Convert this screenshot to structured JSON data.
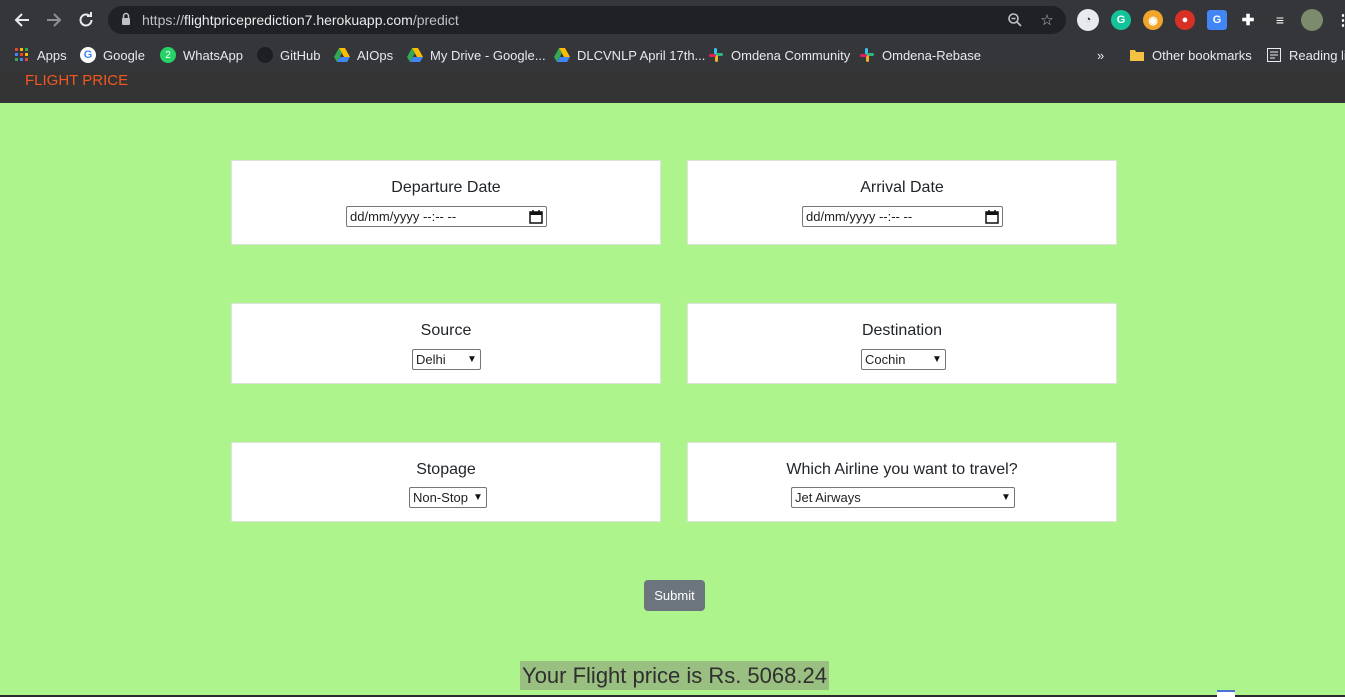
{
  "browser": {
    "url_scheme": "https://",
    "url_host": "flightpriceprediction7.herokuapp.com",
    "url_path": "/predict",
    "bookmarks": [
      {
        "label": "Apps",
        "icon": "apps-grid-icon"
      },
      {
        "label": "Google",
        "icon": "google-icon"
      },
      {
        "label": "WhatsApp",
        "icon": "whatsapp-icon"
      },
      {
        "label": "GitHub",
        "icon": "github-icon"
      },
      {
        "label": "AIOps",
        "icon": "google-drive-icon"
      },
      {
        "label": "My Drive - Google...",
        "icon": "google-drive-icon"
      },
      {
        "label": "DLCVNLP April 17th...",
        "icon": "google-drive-icon"
      },
      {
        "label": "Omdena Community",
        "icon": "slack-icon"
      },
      {
        "label": "Omdena-Rebase",
        "icon": "slack-icon"
      }
    ],
    "more_bookmarks": "»",
    "other_bookmarks": "Other bookmarks",
    "reading_list": "Reading lis",
    "whatsapp_badge": "2"
  },
  "navbar": {
    "brand": "FLIGHT PRICE"
  },
  "form": {
    "departure": {
      "label": "Departure Date",
      "value": "dd/mm/yyyy --:-- --"
    },
    "arrival": {
      "label": "Arrival Date",
      "value": "dd/mm/yyyy --:-- --"
    },
    "source": {
      "label": "Source",
      "value": "Delhi"
    },
    "destination": {
      "label": "Destination",
      "value": "Cochin"
    },
    "stopage": {
      "label": "Stopage",
      "value": "Non-Stop"
    },
    "airline": {
      "label": "Which Airline you want to travel?",
      "value": "Jet Airways"
    },
    "submit_label": "Submit"
  },
  "result": {
    "text": "Your Flight price is Rs. 5068.24"
  },
  "colors": {
    "page_background": "#adf48d",
    "brand": "#f2571f",
    "submit": "#6c757d",
    "result_highlight": "#99bf81"
  }
}
